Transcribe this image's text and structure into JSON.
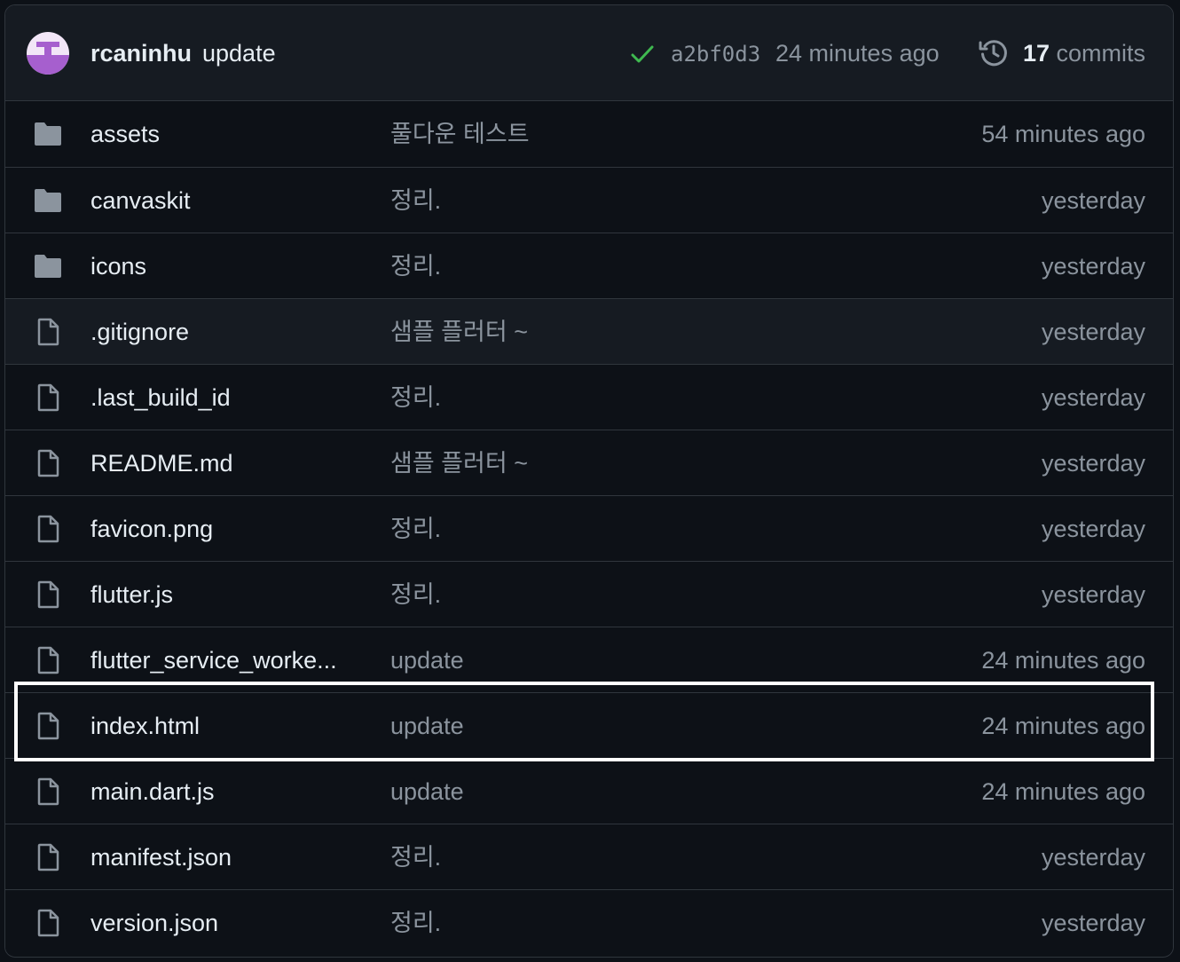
{
  "header": {
    "author": "rcaninhu",
    "message": "update",
    "sha": "a2bf0d3",
    "time_ago": "24 minutes ago",
    "commit_count": "17",
    "commit_label": "commits",
    "status": "success",
    "check_color": "#3fb950"
  },
  "files": [
    {
      "name": "assets",
      "type": "folder",
      "message": "풀다운 테스트",
      "age": "54 minutes ago"
    },
    {
      "name": "canvaskit",
      "type": "folder",
      "message": "정리.",
      "age": "yesterday"
    },
    {
      "name": "icons",
      "type": "folder",
      "message": "정리.",
      "age": "yesterday"
    },
    {
      "name": ".gitignore",
      "type": "file",
      "message": "샘플 플러터 ~",
      "age": "yesterday"
    },
    {
      "name": ".last_build_id",
      "type": "file",
      "message": "정리.",
      "age": "yesterday"
    },
    {
      "name": "README.md",
      "type": "file",
      "message": "샘플 플러터 ~",
      "age": "yesterday"
    },
    {
      "name": "favicon.png",
      "type": "file",
      "message": "정리.",
      "age": "yesterday"
    },
    {
      "name": "flutter.js",
      "type": "file",
      "message": "정리.",
      "age": "yesterday"
    },
    {
      "name": "flutter_service_worke...",
      "type": "file",
      "message": "update",
      "age": "24 minutes ago"
    },
    {
      "name": "index.html",
      "type": "file",
      "message": "update",
      "age": "24 minutes ago",
      "highlighted": true
    },
    {
      "name": "main.dart.js",
      "type": "file",
      "message": "update",
      "age": "24 minutes ago"
    },
    {
      "name": "manifest.json",
      "type": "file",
      "message": "정리.",
      "age": "yesterday"
    },
    {
      "name": "version.json",
      "type": "file",
      "message": "정리.",
      "age": "yesterday"
    }
  ]
}
